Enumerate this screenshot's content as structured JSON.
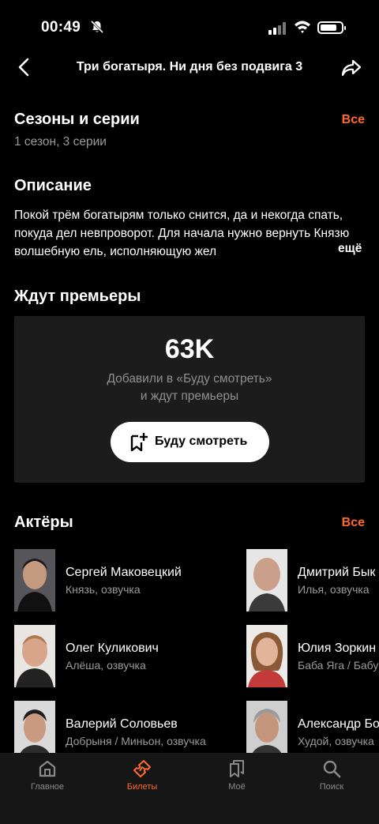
{
  "status": {
    "time": "00:49"
  },
  "header": {
    "title": "Три богатыря. Ни дня без подвига 3"
  },
  "seasons": {
    "heading": "Сезоны и серии",
    "all_label": "Все",
    "summary": "1 сезон, 3 серии"
  },
  "description": {
    "heading": "Описание",
    "text": "Покой трём богатырям только снится, да и некогда спать, покуда дел невпроворот. Для начала нужно вернуть Князю волшебную ель, исполняющую жел",
    "more_label": "ещё"
  },
  "premiere": {
    "heading": "Ждут премьеры",
    "count": "63K",
    "line1": "Добавили в «Буду смотреть»",
    "line2": "и ждут премьеры",
    "button_label": "Буду смотреть"
  },
  "actors": {
    "heading": "Актёры",
    "all_label": "Все",
    "items": [
      {
        "name": "Сергей Маковецкий",
        "role": "Князь, озвучка"
      },
      {
        "name": "Олег Куликович",
        "role": "Алёша, озвучка"
      },
      {
        "name": "Валерий Соловьев",
        "role": "Добрыня / Миньон, озвучка"
      },
      {
        "name": "Дмитрий Бык",
        "role": "Илья, озвучка"
      },
      {
        "name": "Юлия Зоркин",
        "role": "Баба Яга / Бабу"
      },
      {
        "name": "Александр Бо",
        "role": "Худой, озвучка"
      }
    ]
  },
  "tabs": [
    {
      "label": "Главное",
      "icon": "home-icon"
    },
    {
      "label": "Билеты",
      "icon": "ticket-icon"
    },
    {
      "label": "Моё",
      "icon": "bookmarks-icon"
    },
    {
      "label": "Поиск",
      "icon": "search-icon"
    }
  ],
  "colors": {
    "accent": "#ff6a2b",
    "background": "#000000",
    "card": "#1c1c1c"
  }
}
